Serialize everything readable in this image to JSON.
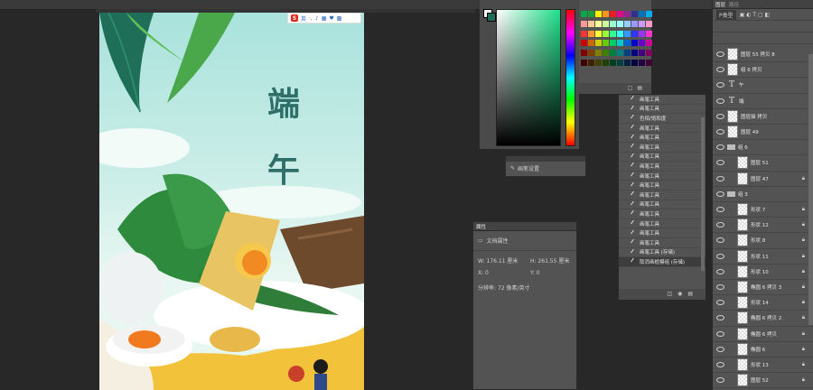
{
  "ime": {
    "logo": "S",
    "lang": "英"
  },
  "canvas": {
    "char1": "端",
    "char2": "午"
  },
  "brush_panel": {
    "label": "画笔设置"
  },
  "properties": {
    "tab": "属性",
    "doc_label": "文档属性",
    "w": "W: 176.11 厘米",
    "h": "H: 261.55 厘米",
    "x": "X: 0",
    "y": "Y: 0",
    "resolution": "分辨率: 72 像素/英寸"
  },
  "history": {
    "items": [
      "画笔工具",
      "画笔工具",
      "色相/饱和度",
      "画笔工具",
      "画笔工具",
      "画笔工具",
      "画笔工具",
      "画笔工具",
      "画笔工具",
      "画笔工具",
      "画笔工具",
      "画笔工具",
      "画笔工具",
      "画笔工具",
      "画笔工具",
      "画笔工具",
      "画笔工具 (存储)",
      "取消画框模组 (存储)"
    ]
  },
  "layers": {
    "tabs": [
      "图层",
      "路径"
    ],
    "kind_label": "P类型",
    "rows": [
      {
        "type": "img",
        "name": "图层 55 拷贝 8",
        "lock": false,
        "indent": 0
      },
      {
        "type": "img",
        "name": "组 6 拷贝",
        "lock": false,
        "indent": 0
      },
      {
        "type": "text",
        "name": "午",
        "lock": false,
        "indent": 0
      },
      {
        "type": "text",
        "name": "端",
        "lock": false,
        "indent": 0
      },
      {
        "type": "img",
        "name": "图层描 拷贝",
        "lock": false,
        "indent": 0
      },
      {
        "type": "img",
        "name": "图层 49",
        "lock": false,
        "indent": 0
      },
      {
        "type": "folder",
        "name": "组 6",
        "lock": false,
        "indent": 0
      },
      {
        "type": "img",
        "name": "图层 51",
        "lock": false,
        "indent": 1
      },
      {
        "type": "img",
        "name": "图层 47",
        "lock": true,
        "indent": 1
      },
      {
        "type": "folder",
        "name": "组 3",
        "lock": false,
        "indent": 0
      },
      {
        "type": "img",
        "name": "形状 7",
        "lock": true,
        "indent": 1
      },
      {
        "type": "img",
        "name": "形状 12",
        "lock": true,
        "indent": 1
      },
      {
        "type": "img",
        "name": "形状 8",
        "lock": true,
        "indent": 1
      },
      {
        "type": "img",
        "name": "形状 11",
        "lock": true,
        "indent": 1
      },
      {
        "type": "img",
        "name": "形状 10",
        "lock": true,
        "indent": 1
      },
      {
        "type": "img",
        "name": "椭圆 6 拷贝 3",
        "lock": true,
        "indent": 1
      },
      {
        "type": "img",
        "name": "形状 14",
        "lock": true,
        "indent": 1
      },
      {
        "type": "img",
        "name": "椭圆 6 拷贝 2",
        "lock": true,
        "indent": 1
      },
      {
        "type": "img",
        "name": "椭圆 6 拷贝",
        "lock": true,
        "indent": 1
      },
      {
        "type": "img",
        "name": "椭圆 6",
        "lock": true,
        "indent": 1
      },
      {
        "type": "img",
        "name": "形状 13",
        "lock": true,
        "indent": 1
      },
      {
        "type": "img",
        "name": "图层 52",
        "lock": true,
        "indent": 1
      }
    ]
  },
  "swatch_colors": [
    "#00a84f",
    "#1b9f3c",
    "#fff200",
    "#f7941d",
    "#ed1c24",
    "#ec008c",
    "#92278f",
    "#2e3192",
    "#0072bc",
    "#00aeef",
    "#ff9999",
    "#ffcc99",
    "#ffff99",
    "#ccff99",
    "#99ffcc",
    "#99ffff",
    "#99ccff",
    "#9999ff",
    "#cc99ff",
    "#ff99cc",
    "#ff3333",
    "#ff9933",
    "#ffff33",
    "#99ff33",
    "#33ff99",
    "#33ffff",
    "#3399ff",
    "#3333ff",
    "#9933ff",
    "#ff33cc",
    "#cc0000",
    "#cc6600",
    "#cccc00",
    "#66cc00",
    "#00cc66",
    "#00cccc",
    "#0066cc",
    "#0000cc",
    "#6600cc",
    "#cc0099",
    "#800000",
    "#804000",
    "#808000",
    "#408000",
    "#008040",
    "#008080",
    "#004080",
    "#000080",
    "#400080",
    "#800060",
    "#400000",
    "#402000",
    "#404000",
    "#204000",
    "#004020",
    "#004040",
    "#002040",
    "#000040",
    "#200040",
    "#400030"
  ]
}
